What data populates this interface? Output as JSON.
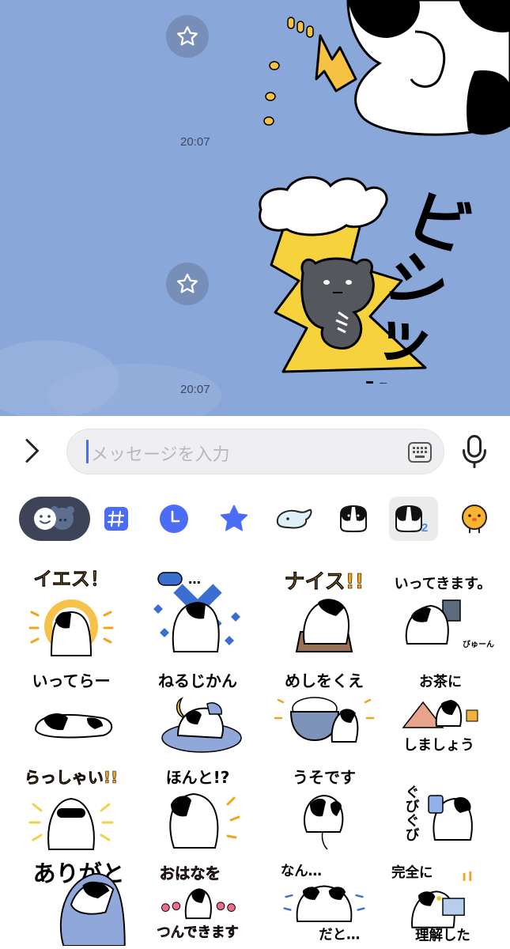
{
  "chat": {
    "messages": [
      {
        "time": "20:07",
        "sticker": "cow-sitting-sticker"
      },
      {
        "time": "20:07",
        "sticker": "bear-lightning-sticker"
      }
    ],
    "sticker_text": "ビシッッッ",
    "background_color": "#8AA7D9"
  },
  "composer": {
    "placeholder": "メッセージを入力",
    "expand_icon": "chevron-right-icon",
    "keyboard_icon": "keyboard-icon",
    "mic_icon": "microphone-icon"
  },
  "tabs": [
    {
      "name": "emoji",
      "selected": true
    },
    {
      "name": "hashtag"
    },
    {
      "name": "recent"
    },
    {
      "name": "favorites"
    },
    {
      "name": "sticker-pack-whale"
    },
    {
      "name": "sticker-pack-cow"
    },
    {
      "name": "sticker-pack-cow-2",
      "badge": "2",
      "highlighted": true
    },
    {
      "name": "sticker-pack-chick"
    }
  ],
  "stickers": [
    {
      "text": "イエス！"
    },
    {
      "text": "〇…"
    },
    {
      "text": "ナイス!!"
    },
    {
      "text": "いってきます。",
      "sub": "びゅーん"
    },
    {
      "text": "いってらー"
    },
    {
      "text": "ねるじかん"
    },
    {
      "text": "めしをくえ"
    },
    {
      "text": "お茶に",
      "sub": "しましょう"
    },
    {
      "text": "らっしゃい!!"
    },
    {
      "text": "ほんと!?"
    },
    {
      "text": "うそです"
    },
    {
      "text": "ぐびぐび"
    },
    {
      "text": "ありがとう"
    },
    {
      "text": "おはなを",
      "sub": "つんできます"
    },
    {
      "text": "なん…",
      "sub": "だと…"
    },
    {
      "text": "完全に",
      "sub": "理解した"
    }
  ]
}
